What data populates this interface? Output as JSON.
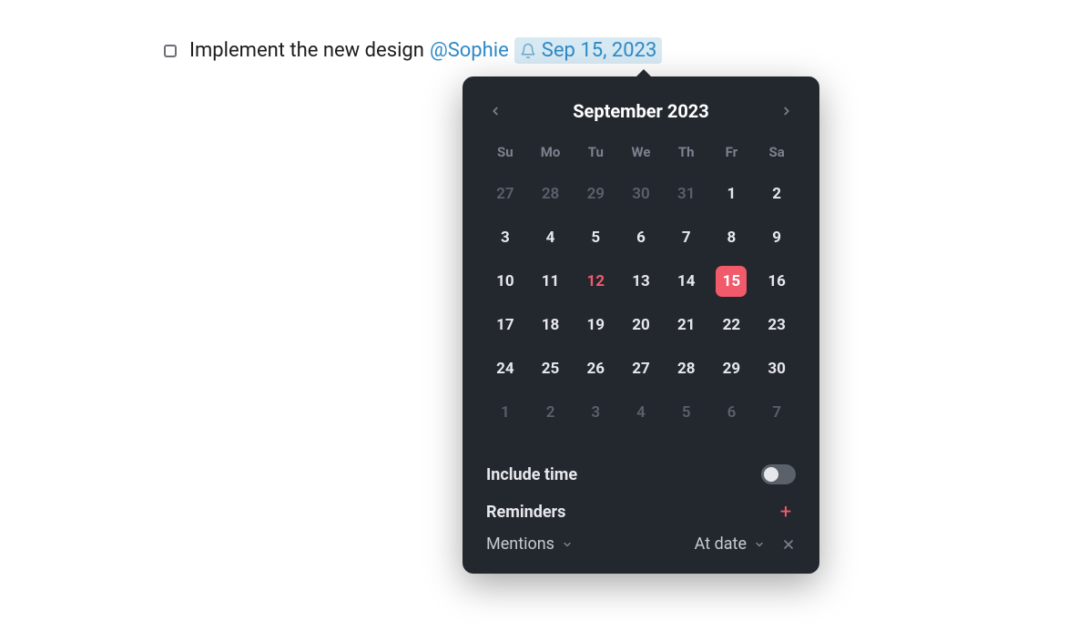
{
  "task": {
    "text": "Implement the new design",
    "mention": "@Sophie",
    "date_text": "Sep 15, 2023"
  },
  "calendar": {
    "title": "September 2023",
    "dow": [
      "Su",
      "Mo",
      "Tu",
      "We",
      "Th",
      "Fr",
      "Sa"
    ],
    "today": 12,
    "selected": 15,
    "days": [
      {
        "n": 27,
        "other": true
      },
      {
        "n": 28,
        "other": true
      },
      {
        "n": 29,
        "other": true
      },
      {
        "n": 30,
        "other": true
      },
      {
        "n": 31,
        "other": true
      },
      {
        "n": 1
      },
      {
        "n": 2
      },
      {
        "n": 3
      },
      {
        "n": 4
      },
      {
        "n": 5
      },
      {
        "n": 6
      },
      {
        "n": 7
      },
      {
        "n": 8
      },
      {
        "n": 9
      },
      {
        "n": 10
      },
      {
        "n": 11
      },
      {
        "n": 12
      },
      {
        "n": 13
      },
      {
        "n": 14
      },
      {
        "n": 15
      },
      {
        "n": 16
      },
      {
        "n": 17
      },
      {
        "n": 18
      },
      {
        "n": 19
      },
      {
        "n": 20
      },
      {
        "n": 21
      },
      {
        "n": 22
      },
      {
        "n": 23
      },
      {
        "n": 24
      },
      {
        "n": 25
      },
      {
        "n": 26
      },
      {
        "n": 27
      },
      {
        "n": 28
      },
      {
        "n": 29
      },
      {
        "n": 30
      },
      {
        "n": 1,
        "other": true
      },
      {
        "n": 2,
        "other": true
      },
      {
        "n": 3,
        "other": true
      },
      {
        "n": 4,
        "other": true
      },
      {
        "n": 5,
        "other": true
      },
      {
        "n": 6,
        "other": true
      },
      {
        "n": 7,
        "other": true
      }
    ]
  },
  "include_time_label": "Include time",
  "reminders_label": "Reminders",
  "reminder_type": {
    "label": "Mentions"
  },
  "reminder_timing": {
    "label": "At date"
  }
}
